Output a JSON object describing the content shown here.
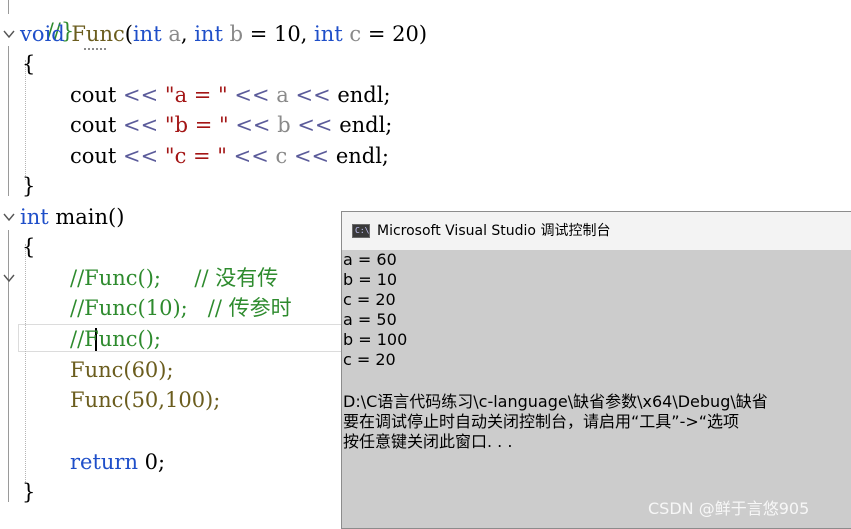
{
  "editor": {
    "top_partial": "//}",
    "func_def": {
      "kw_void": "void",
      "name": "Func",
      "open": "(",
      "kw_int1": "int",
      "p_a": " a",
      "sep1": ", ",
      "kw_int2": "int",
      "p_b": " b",
      "def_b": " = 10, ",
      "kw_int3": "int",
      "p_c": " c",
      "def_c": " = 20)"
    },
    "brace_open1": "{",
    "cout_a": {
      "cout": "cout ",
      "op1": "<< ",
      "str": "\"a = \"",
      "op2": " << ",
      "var": "a",
      "op3": " << ",
      "endl": "endl;"
    },
    "cout_b": {
      "cout": "cout ",
      "op1": "<< ",
      "str": "\"b = \"",
      "op2": " << ",
      "var": "b",
      "op3": " << ",
      "endl": "endl;"
    },
    "cout_c": {
      "cout": "cout ",
      "op1": "<< ",
      "str": "\"c = \"",
      "op2": " << ",
      "var": "c",
      "op3": " << ",
      "endl": "endl;"
    },
    "brace_close1": "}",
    "main_def": {
      "kw_int": "int",
      "rest": " main()"
    },
    "brace_open2": "{",
    "comment1": {
      "code": "//Func();",
      "gap": "     ",
      "note": "// 没有传"
    },
    "comment2": {
      "code": "//Func(10);",
      "gap": "   ",
      "note": "// 传参时"
    },
    "comment3": {
      "slashes": "//",
      "rest": "Func();"
    },
    "call1": "Func(60);",
    "call2": "Func(50,100);",
    "ret": {
      "kw": "return",
      "rest": " 0;"
    },
    "brace_close2": "}"
  },
  "console": {
    "title": "Microsoft Visual Studio 调试控制台",
    "icon_label": "C:\\",
    "lines": [
      "a = 60",
      "b = 10",
      "c = 20",
      "a = 50",
      "b = 100",
      "c = 20",
      "",
      "D:\\C语言代码练习\\c-language\\缺省参数\\x64\\Debug\\缺省",
      "要在调试停止时自动关闭控制台，请启用“工具”->“选项",
      "按任意键关闭此窗口. . ."
    ]
  },
  "watermark": "CSDN @鲜于言悠905"
}
